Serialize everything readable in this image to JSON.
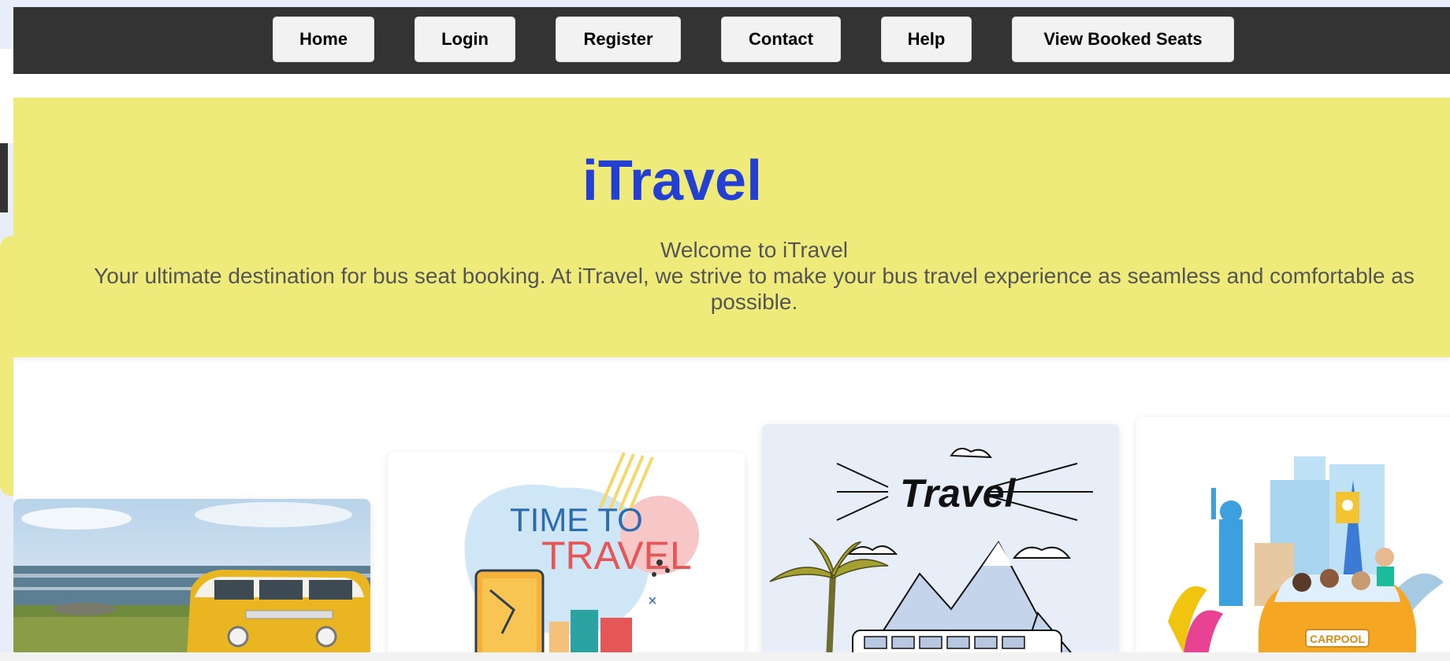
{
  "nav": {
    "items": [
      {
        "label": "Home"
      },
      {
        "label": "Login"
      },
      {
        "label": "Register"
      },
      {
        "label": "Contact"
      },
      {
        "label": "Help"
      },
      {
        "label": "View Booked Seats"
      }
    ]
  },
  "hero": {
    "title": "iTravel",
    "welcome": "Welcome to iTravel",
    "tagline": "Your ultimate destination for bus seat booking. At iTravel, we strive to make your bus travel experience as seamless and comfortable as possible."
  },
  "cards": [
    {
      "image": "yellow-van-beach-image"
    },
    {
      "image": "time-to-travel-illustration",
      "text_top": "TIME TO",
      "text_bottom": "TRAVEL"
    },
    {
      "image": "travel-bus-mountains-illustration",
      "text": "Travel"
    },
    {
      "image": "carpool-landmarks-illustration",
      "text": "CARPOOL"
    }
  ],
  "colors": {
    "nav_bg": "#333333",
    "hero_bg": "#efeb7a",
    "title": "#2440d3",
    "text": "#555555"
  }
}
